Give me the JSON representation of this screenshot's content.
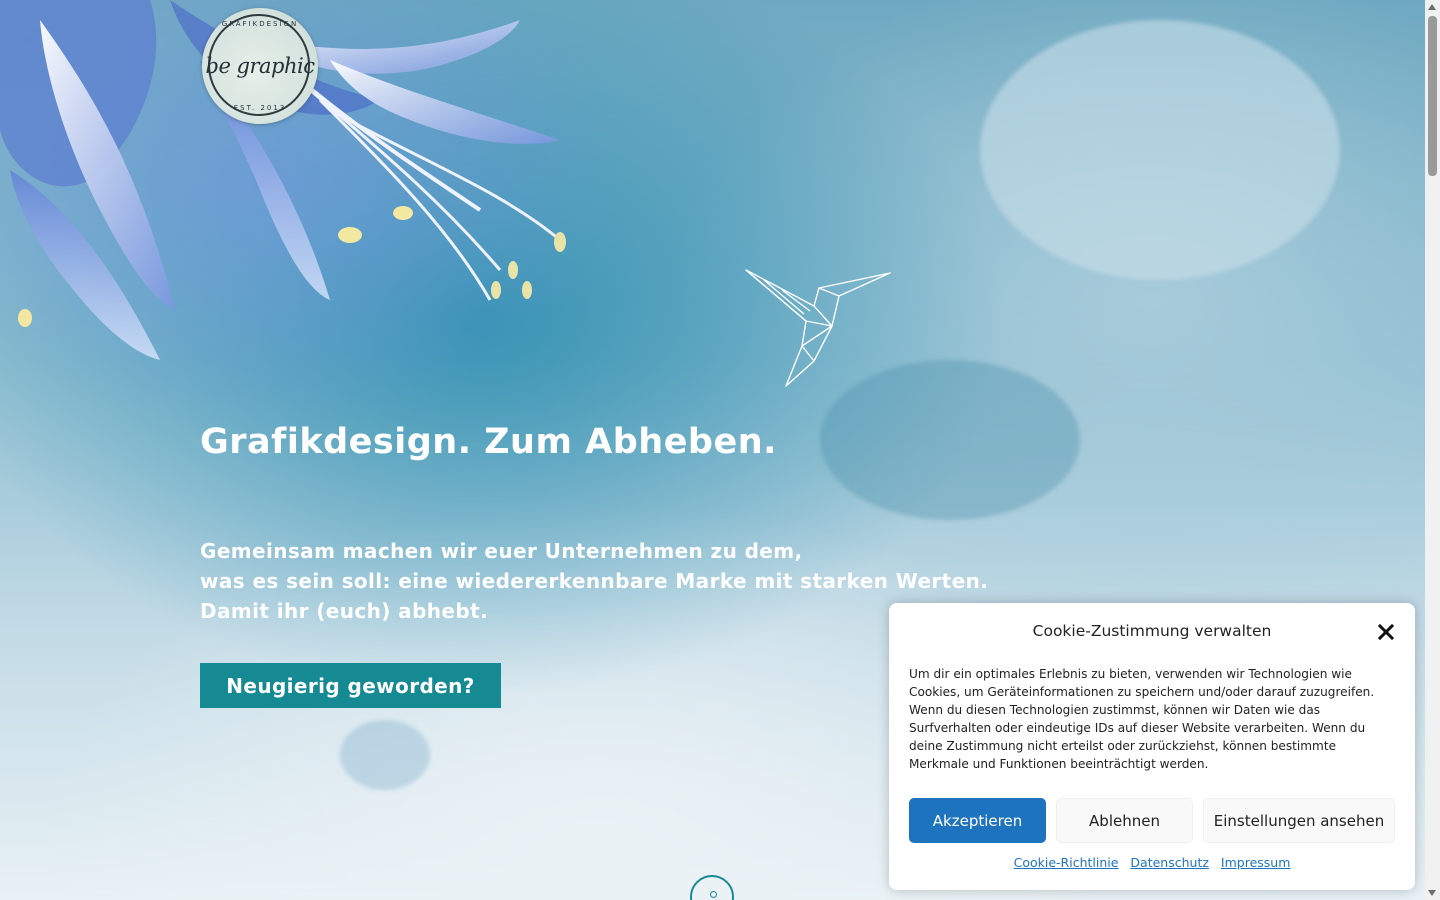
{
  "logo": {
    "top_text": "GRAFIKDESIGN",
    "main_text": "be graphic",
    "bottom_text": "EST. 2013"
  },
  "hero": {
    "headline": "Grafikdesign. Zum Abheben.",
    "sub_lines": [
      "Gemeinsam machen wir euer Unternehmen zu dem,",
      "was es sein soll: eine wiedererkennbare Marke mit starken Werten.",
      "Damit ihr (euch) abhebt."
    ],
    "cta_label": "Neugierig geworden?"
  },
  "cookie_banner": {
    "title": "Cookie-Zustimmung verwalten",
    "text": "Um dir ein optimales Erlebnis zu bieten, verwenden wir Technologien wie Cookies, um Geräteinformationen zu speichern und/oder darauf zuzugreifen. Wenn du diesen Technologien zustimmst, können wir Daten wie das Surfverhalten oder eindeutige IDs auf dieser Website verarbeiten. Wenn du deine Zustimmung nicht erteilst oder zurückziehst, können bestimmte Merkmale und Funktionen beeinträchtigt werden.",
    "accept_label": "Akzeptieren",
    "deny_label": "Ablehnen",
    "preferences_label": "Einstellungen ansehen",
    "links": [
      "Cookie-Richtlinie",
      "Datenschutz",
      "Impressum"
    ]
  },
  "colors": {
    "accent_teal": "#168a93",
    "accept_blue": "#1e73be"
  },
  "icons": [
    "close-icon",
    "hummingbird-icon",
    "scroll-down-icon"
  ]
}
